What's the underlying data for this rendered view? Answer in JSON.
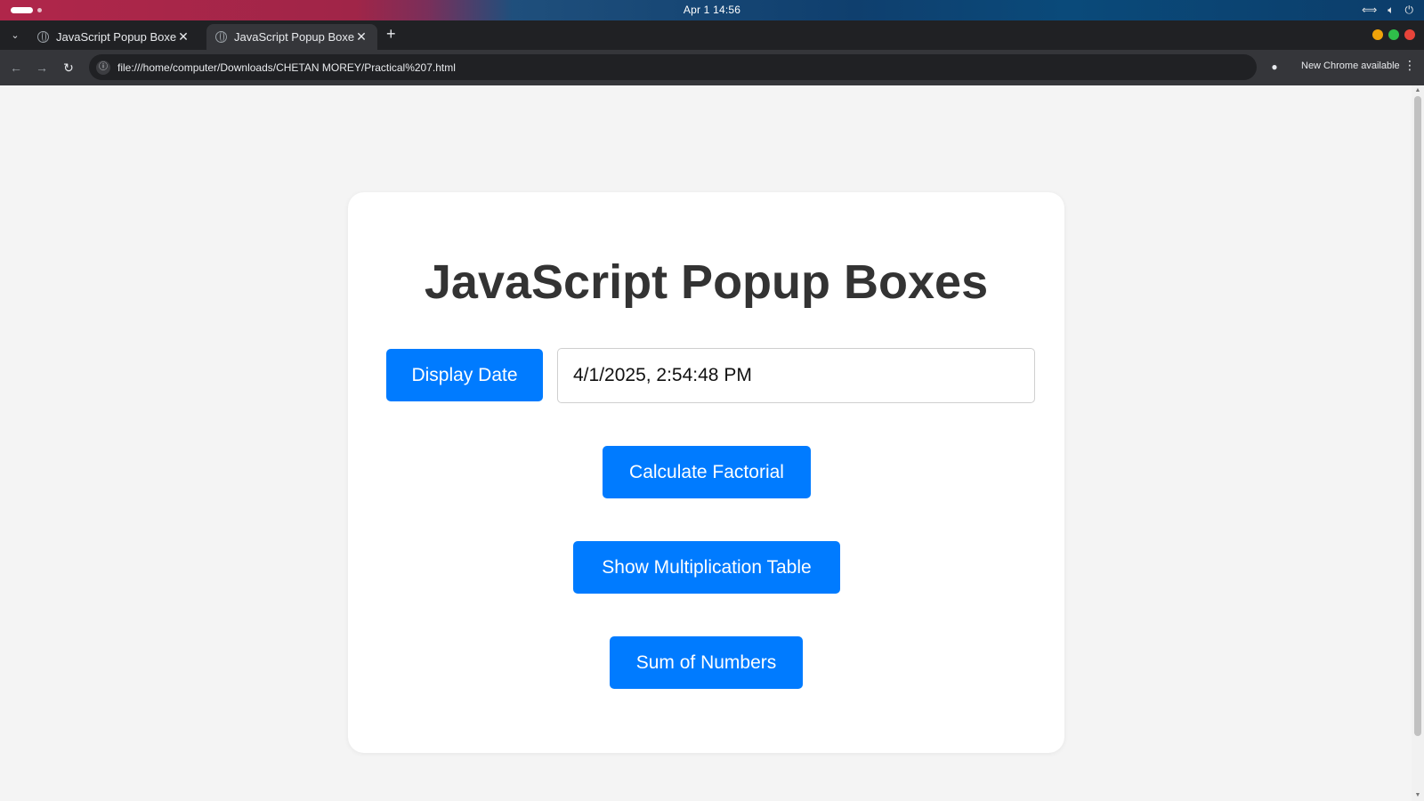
{
  "os": {
    "clock": "Apr 1  14:56"
  },
  "browser": {
    "tabs": [
      {
        "title": "JavaScript Popup Boxes",
        "active": false
      },
      {
        "title": "JavaScript Popup Boxes",
        "active": true
      }
    ],
    "url": "file:///home/computer/Downloads/CHETAN MOREY/Practical%207.html",
    "update_notice": "New Chrome available"
  },
  "page": {
    "title": "JavaScript Popup Boxes",
    "display_date_label": "Display Date",
    "date_value": "4/1/2025, 2:54:48 PM",
    "factorial_label": "Calculate Factorial",
    "multiplication_label": "Show Multiplication Table",
    "sum_label": "Sum of Numbers"
  },
  "colors": {
    "primary_button": "#007bff",
    "page_background": "#f4f4f4",
    "card_background": "#ffffff",
    "title_text": "#333333"
  },
  "icons": [
    "tab-search-icon",
    "globe-icon",
    "close-icon",
    "plus-icon",
    "back-icon",
    "forward-icon",
    "reload-icon",
    "site-info-icon",
    "profile-icon",
    "kebab-menu-icon"
  ]
}
